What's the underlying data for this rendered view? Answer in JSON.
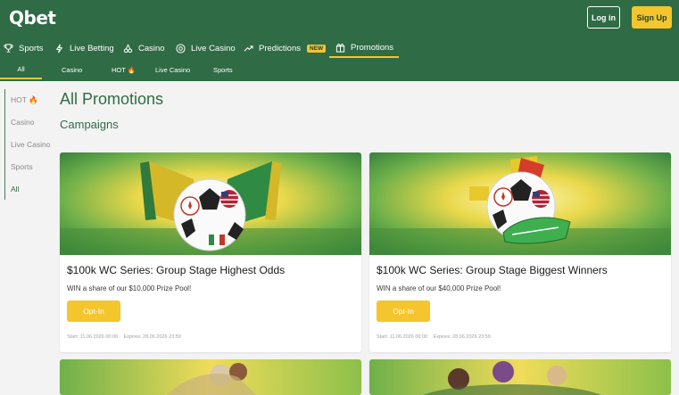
{
  "header": {
    "logo": "Qbet",
    "login_label": "Log in",
    "signup_label": "Sign Up"
  },
  "main_nav": {
    "items": [
      {
        "label": "Sports",
        "icon": "trophy-icon"
      },
      {
        "label": "Live Betting",
        "icon": "lightning-icon"
      },
      {
        "label": "Casino",
        "icon": "cherries-icon"
      },
      {
        "label": "Live Casino",
        "icon": "chip-icon"
      },
      {
        "label": "Predictions",
        "icon": "trend-up-icon",
        "badge": "NEW"
      },
      {
        "label": "Promotions",
        "icon": "gift-icon",
        "active": true
      }
    ]
  },
  "sub_nav": {
    "items": [
      {
        "label": "All",
        "active": true
      },
      {
        "label": "Casino"
      },
      {
        "label": "HOT 🔥"
      },
      {
        "label": "Live Casino"
      },
      {
        "label": "Sports"
      }
    ]
  },
  "sidebar": {
    "items": [
      {
        "label": "HOT 🔥"
      },
      {
        "label": "Casino"
      },
      {
        "label": "Live Casino"
      },
      {
        "label": "Sports"
      },
      {
        "label": "All",
        "active": true
      }
    ]
  },
  "page": {
    "title": "All Promotions",
    "section": "Campaigns"
  },
  "cards": [
    {
      "title": "$100k WC Series: Group Stage Highest Odds",
      "description": "WIN a share of our $10,000 Prize Pool!",
      "button": "Opt-In",
      "start": "Start: 11.06.2026 00:00",
      "expires": "Expires: 28.06.2026 23:59"
    },
    {
      "title": "$100k WC Series: Group Stage Biggest Winners",
      "description": "WIN a share of our $40,000 Prize Pool!",
      "button": "Opt-In",
      "start": "Start: 11.06.2026 00:00",
      "expires": "Expires: 28.06.2026 23:59"
    }
  ],
  "colors": {
    "brand_green": "#2f6b45",
    "accent_yellow": "#f4c52d",
    "background": "#f3f3f3"
  }
}
